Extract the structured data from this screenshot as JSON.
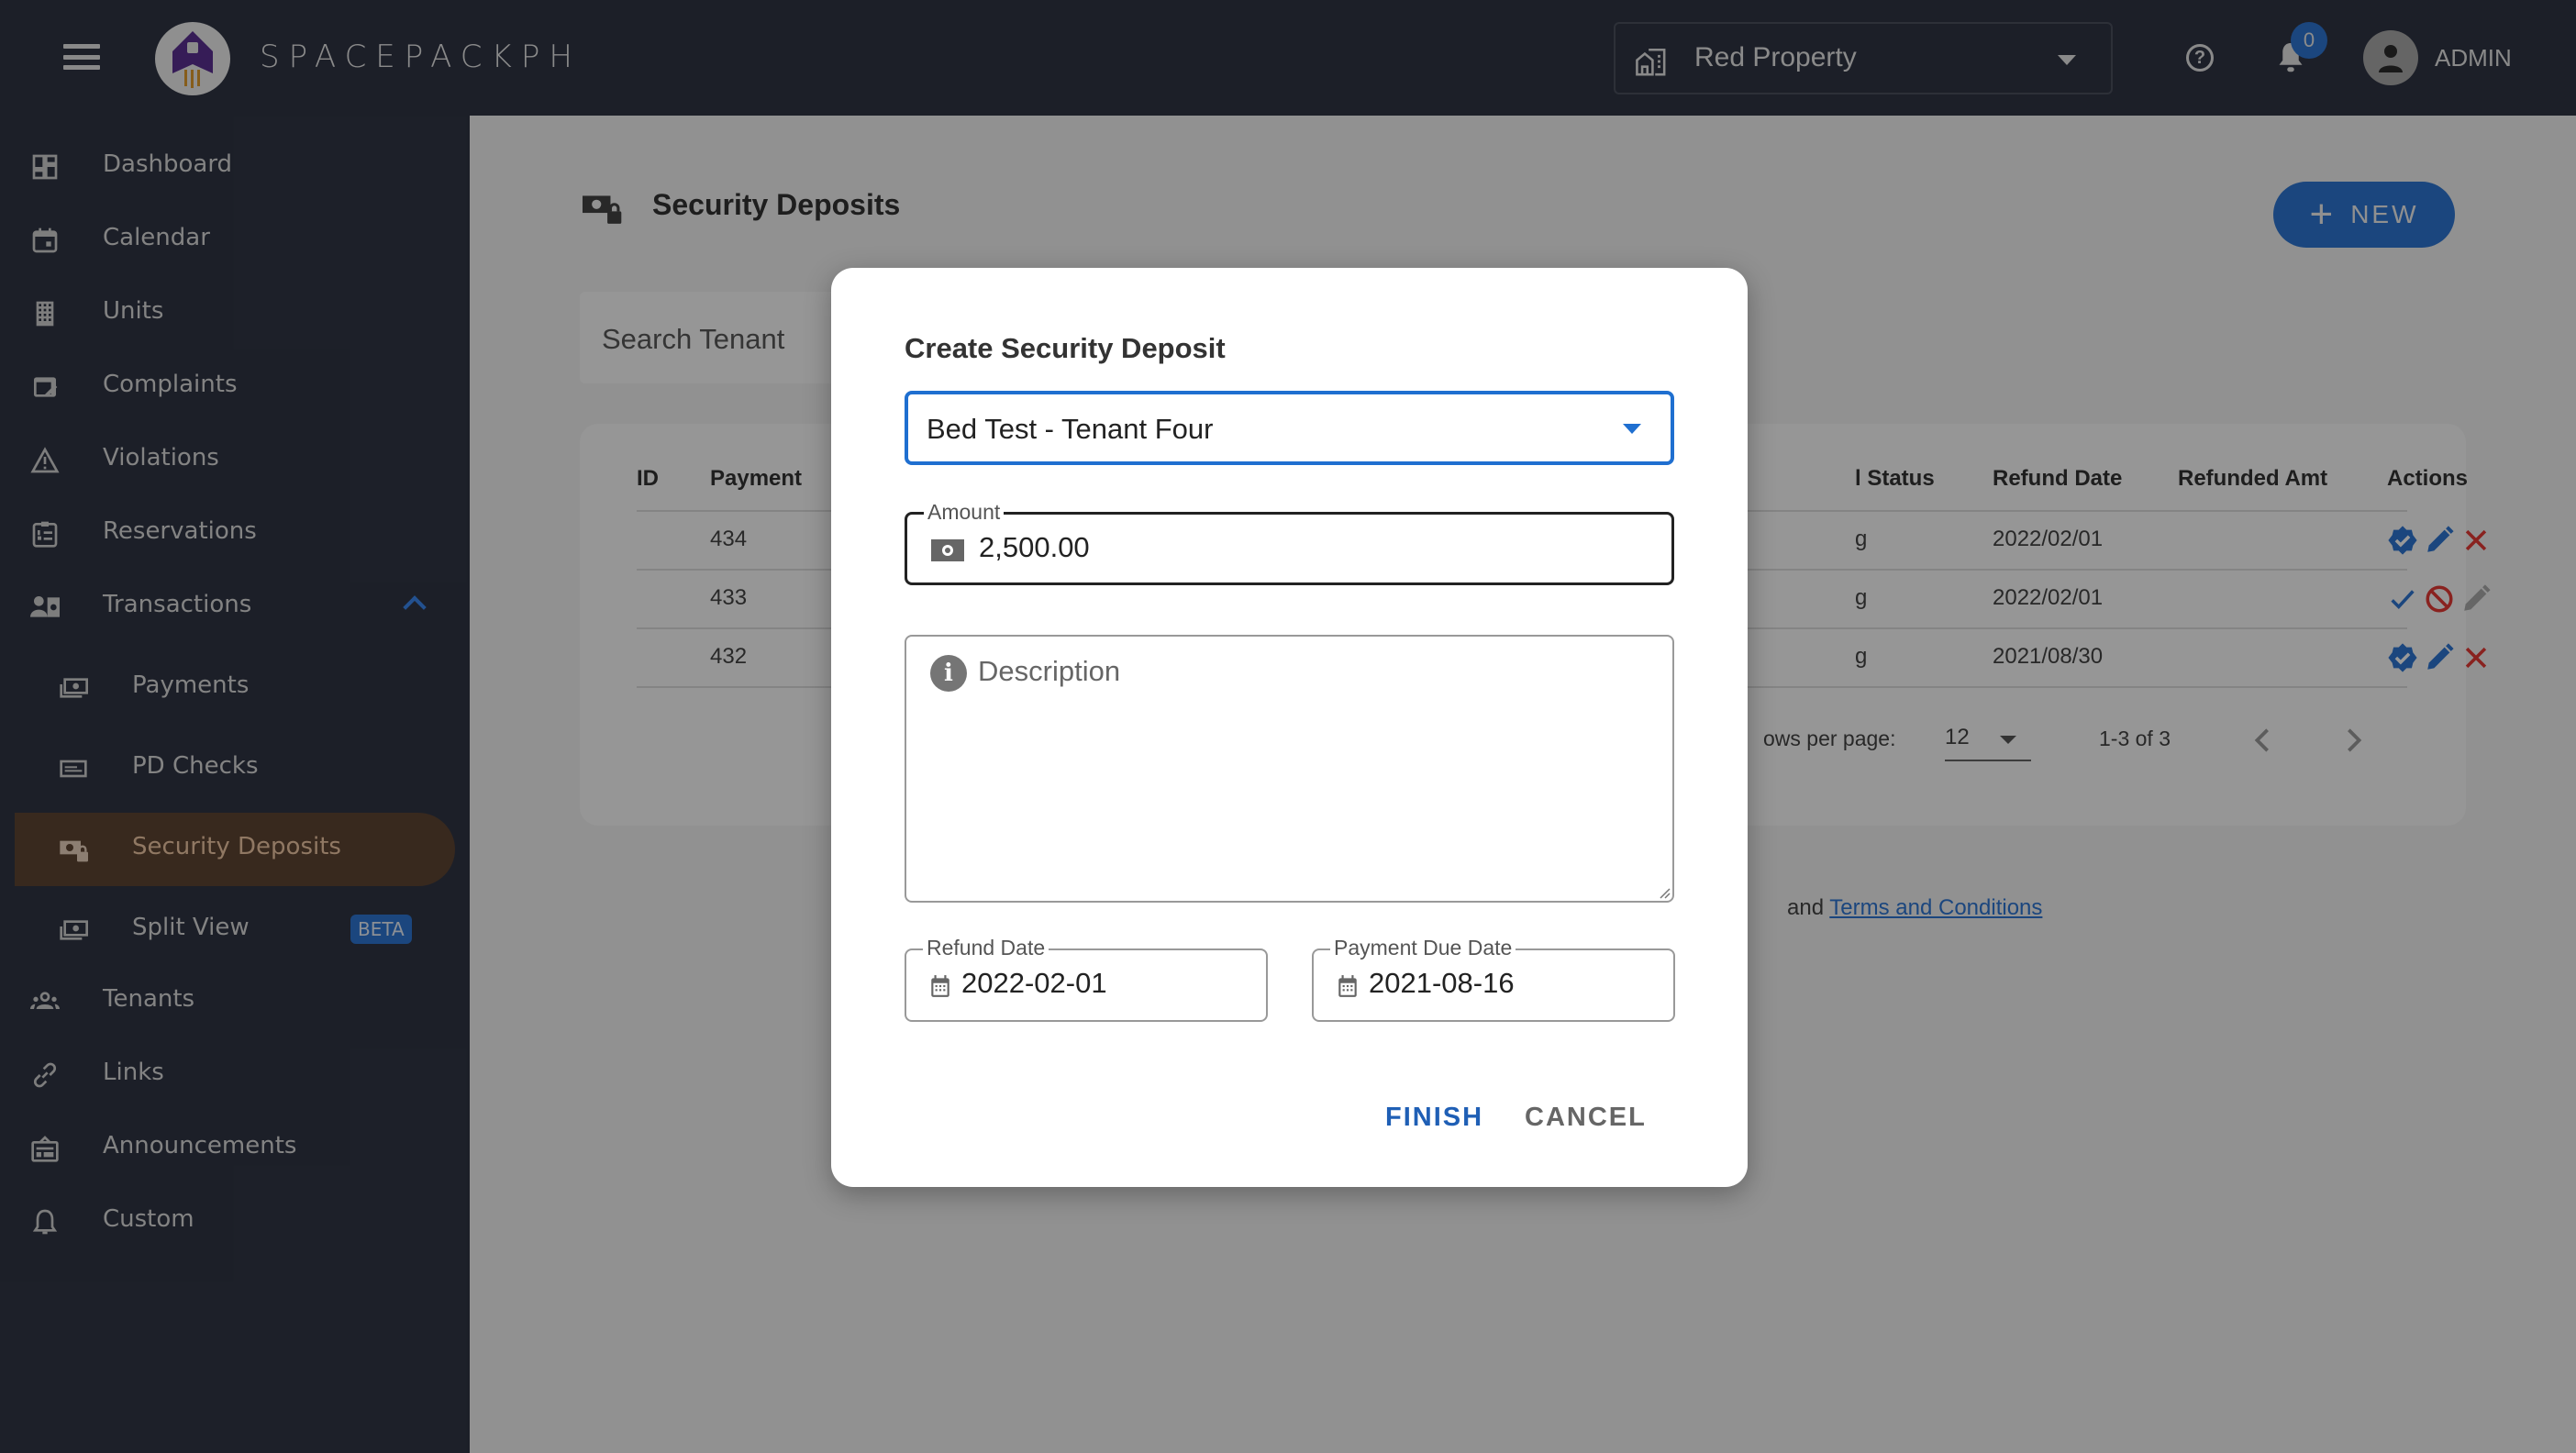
{
  "header": {
    "brand": "SPACEPACKPH",
    "property_select": "Red Property",
    "notification_count": "0",
    "user_label": "ADMIN"
  },
  "sidebar": {
    "items": [
      {
        "label": "Dashboard",
        "icon": "dashboard-icon"
      },
      {
        "label": "Calendar",
        "icon": "calendar-icon"
      },
      {
        "label": "Units",
        "icon": "building-icon"
      },
      {
        "label": "Complaints",
        "icon": "complaint-icon"
      },
      {
        "label": "Violations",
        "icon": "warning-icon"
      },
      {
        "label": "Reservations",
        "icon": "clipboard-list-icon"
      },
      {
        "label": "Transactions",
        "icon": "transactions-icon",
        "expanded": true
      },
      {
        "label": "Payments",
        "icon": "payments-icon",
        "sub": true
      },
      {
        "label": "PD Checks",
        "icon": "check-icon",
        "sub": true
      },
      {
        "label": "Security Deposits",
        "icon": "security-deposit-icon",
        "sub": true,
        "active": true
      },
      {
        "label": "Split View",
        "icon": "payments-icon",
        "sub": true,
        "badge": "BETA"
      },
      {
        "label": "Tenants",
        "icon": "people-icon"
      },
      {
        "label": "Links",
        "icon": "link-icon"
      },
      {
        "label": "Announcements",
        "icon": "announcement-icon"
      },
      {
        "label": "Custom",
        "icon": "bell-icon"
      }
    ]
  },
  "main": {
    "page_title": "Security Deposits",
    "new_button": "NEW",
    "search_placeholder": "Search Tenant",
    "table": {
      "columns_left": [
        "ID",
        "Payment"
      ],
      "columns_right": [
        "l Status",
        "Refund Date",
        "Refunded Amt",
        "Actions"
      ],
      "rows": [
        {
          "payment": "434",
          "status_fragment": "g",
          "refund_date": "2022/02/01",
          "refunded_amt": "",
          "actions": [
            "verified",
            "edit",
            "delete"
          ]
        },
        {
          "payment": "433",
          "status_fragment": "g",
          "refund_date": "2022/02/01",
          "refunded_amt": "",
          "actions": [
            "approve",
            "reject",
            "edit-disabled"
          ]
        },
        {
          "payment": "432",
          "status_fragment": "g",
          "refund_date": "2021/08/30",
          "refunded_amt": "",
          "actions": [
            "verified",
            "edit",
            "delete"
          ]
        }
      ]
    },
    "pagination": {
      "rows_per_page_label": "ows per page:",
      "rows_per_page": "12",
      "range": "1-3 of 3"
    },
    "footer_prefix": "and",
    "footer_link": "Terms and Conditions"
  },
  "dialog": {
    "title": "Create Security Deposit",
    "tenant_select": "Bed Test - Tenant Four",
    "amount_label": "Amount",
    "amount_value": "2,500.00",
    "description_placeholder": "Description",
    "refund_date_label": "Refund Date",
    "refund_date_value": "2022-02-01",
    "payment_due_label": "Payment Due Date",
    "payment_due_value": "2021-08-16",
    "finish_label": "FINISH",
    "cancel_label": "CANCEL"
  },
  "colors": {
    "topbar": "#303544",
    "accent": "#2d75d2",
    "active_nav": "#5e4532",
    "danger": "#d32f2f"
  }
}
